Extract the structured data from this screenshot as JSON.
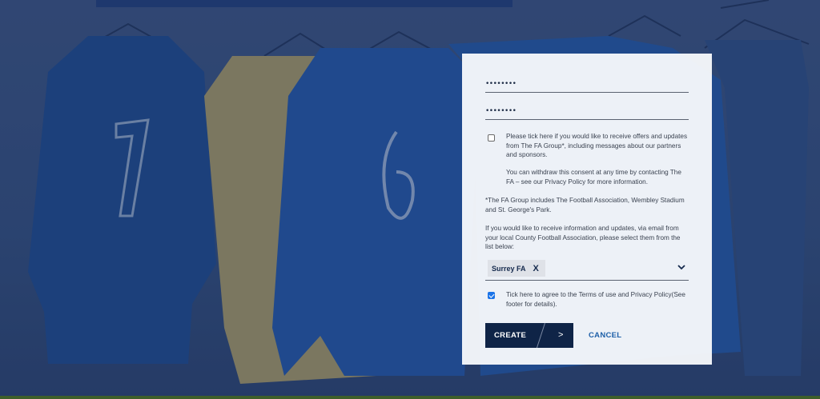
{
  "form": {
    "password_value": "••••••••",
    "confirm_password_value": "••••••••",
    "offers_consent": {
      "checked": false,
      "label": "Please tick here if you would like to receive offers and updates from The FA Group*, including messages about our partners and sponsors.",
      "withdraw_note": "You can withdraw this consent at any time by contacting The FA – see our Privacy Policy for more information."
    },
    "fa_group_note": "*The FA Group includes The Football Association, Wembley Stadium and St. George's Park.",
    "county_info": "If you would like to receive information and updates, via email from your local County Football Association, please select them from the list below:",
    "county_select": {
      "selected_chip": "Surrey FA",
      "chip_remove": "X"
    },
    "terms": {
      "checked": true,
      "label": "Tick here to agree to the Terms of use and Privacy Policy(See footer for details)."
    },
    "create_label": "CREATE",
    "create_arrow": ">",
    "cancel_label": "CANCEL"
  },
  "colors": {
    "primary_navy": "#0f2447",
    "link_blue": "#1d5fa8",
    "checkbox_blue": "#1a73e8"
  },
  "icons": {
    "dropdown": "chevron-down-icon",
    "chip_remove": "close-icon"
  }
}
